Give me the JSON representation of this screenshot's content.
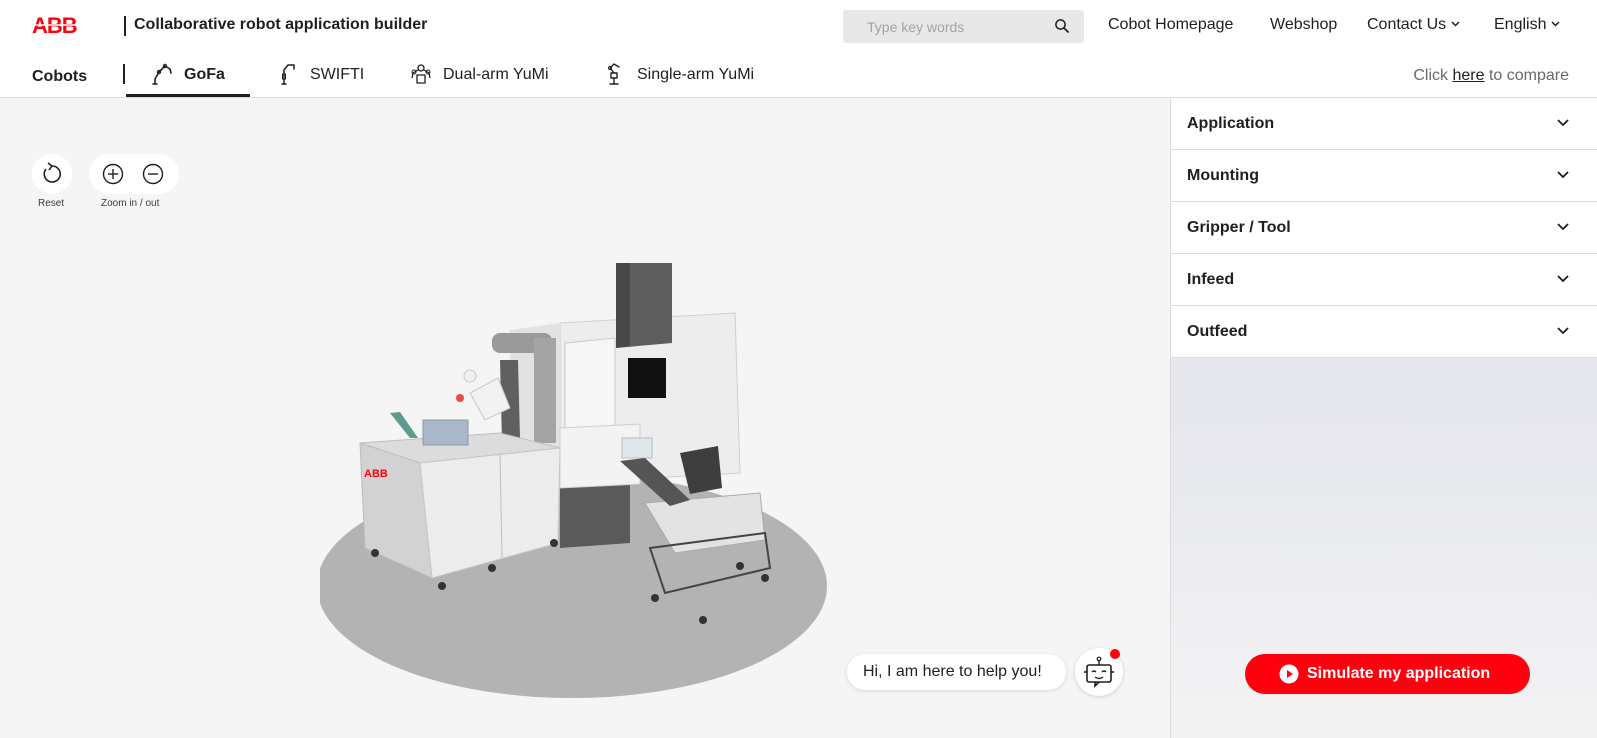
{
  "header": {
    "logo_text": "ABB",
    "title": "Collaborative robot application builder",
    "search_placeholder": "Type key words",
    "links": {
      "cobot_homepage": "Cobot Homepage",
      "webshop": "Webshop",
      "contact_us": "Contact Us",
      "language": "English"
    }
  },
  "subnav": {
    "label": "Cobots",
    "tabs": [
      {
        "label": "GoFa",
        "icon": "gofa-robot-icon",
        "active": true
      },
      {
        "label": "SWIFTI",
        "icon": "swifti-robot-icon",
        "active": false
      },
      {
        "label": "Dual-arm YuMi",
        "icon": "dual-arm-yumi-icon",
        "active": false
      },
      {
        "label": "Single-arm YuMi",
        "icon": "single-arm-yumi-icon",
        "active": false
      }
    ],
    "compare_prefix": "Click ",
    "compare_link": "here",
    "compare_suffix": " to compare"
  },
  "viewer": {
    "reset_label": "Reset",
    "zoom_label": "Zoom in / out",
    "cabinet_logo": "ABB",
    "chat_prompt": "Hi, I am here to help you!"
  },
  "panel": {
    "sections": [
      {
        "label": "Application"
      },
      {
        "label": "Mounting"
      },
      {
        "label": "Gripper / Tool"
      },
      {
        "label": "Infeed"
      },
      {
        "label": "Outfeed"
      }
    ],
    "simulate_label": "Simulate my application"
  },
  "colors": {
    "brand_red": "#ff000f",
    "text": "#1f1f1f",
    "viewer_bg": "#f5f5f5",
    "panel_bg": "#e3e4ea"
  }
}
